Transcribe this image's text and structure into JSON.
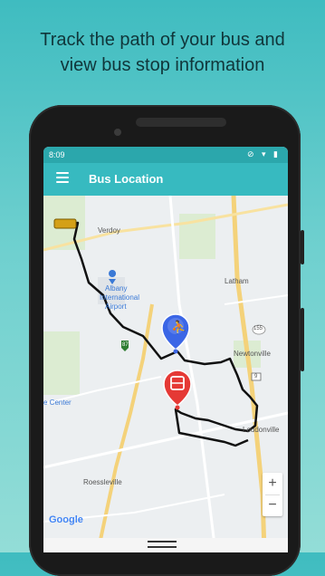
{
  "headline": {
    "line1": "Track the path of your bus and",
    "line2": "view bus stop information"
  },
  "statusbar": {
    "time": "8:09",
    "icons": "⊘ ▾ ▮"
  },
  "appbar": {
    "title": "Bus Location",
    "menu_icon": "hamburger-menu-icon"
  },
  "map": {
    "labels": {
      "verdoy": "Verdoy",
      "albany1": "Albany",
      "albany2": "International",
      "albany3": "Airport",
      "latham": "Latham",
      "newtonville": "Newtonville",
      "loudonville": "Loudonville",
      "center": "e Center",
      "roessleville": "Roessleville",
      "route87": "87",
      "route155": "155",
      "route9": "9"
    },
    "zoom_in": "+",
    "zoom_out": "−",
    "attribution": "Google",
    "colors": {
      "route": "#111111",
      "bus_stop_marker": "#3b66e6",
      "bus_marker": "#e53935",
      "school_bus": "#d4a017"
    }
  }
}
